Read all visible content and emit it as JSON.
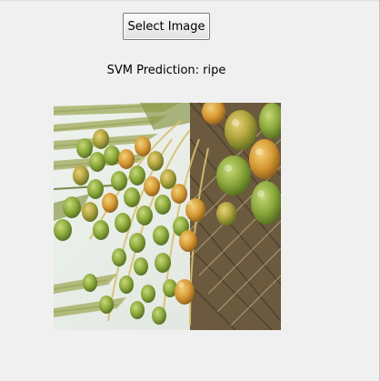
{
  "window": {
    "background": "#f0f0f0"
  },
  "select_button": {
    "label": "Select Image"
  },
  "prediction": {
    "text": "SVM Prediction: ripe"
  },
  "image": {
    "subject": "cluster of green and orange areca nuts on palm tree"
  }
}
